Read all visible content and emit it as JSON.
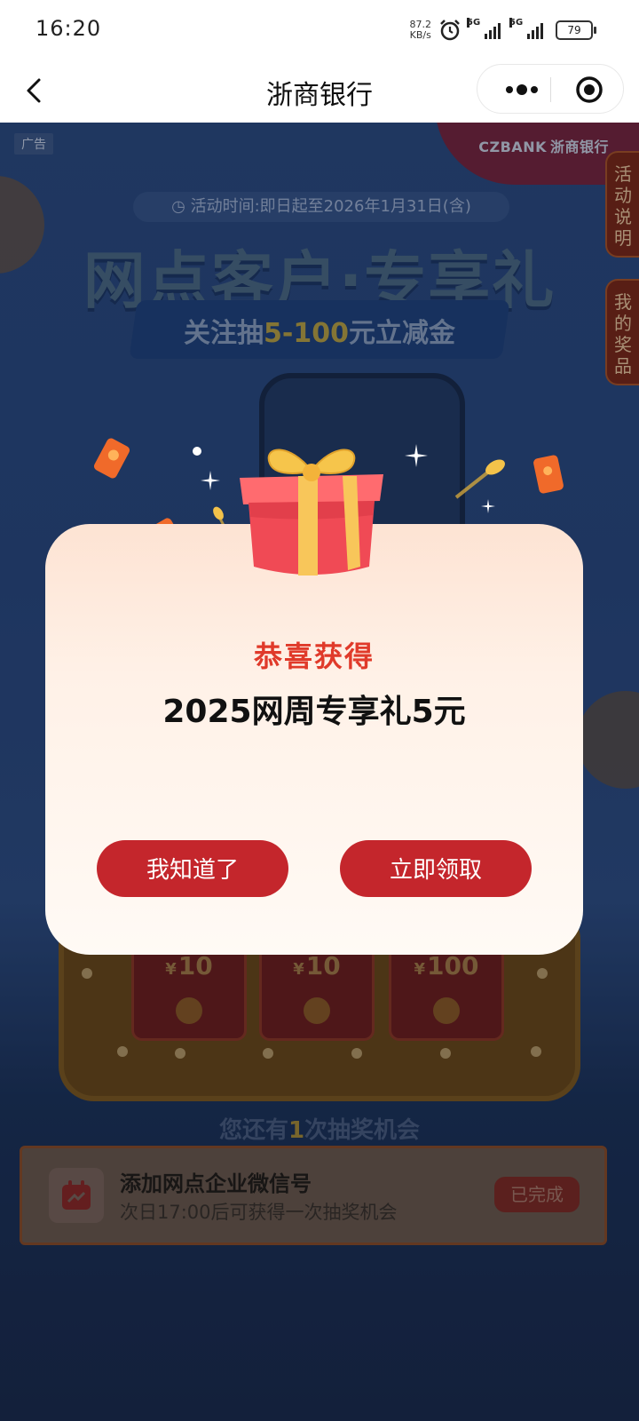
{
  "status_bar": {
    "time": "16:20",
    "net_speed_value": "87.2",
    "net_speed_unit": "KB/s",
    "sim1": "5G",
    "sim2": "5G",
    "battery": "79"
  },
  "nav": {
    "title": "浙商银行"
  },
  "background": {
    "ad_label": "广告",
    "brand_en": "CZBANK",
    "brand_cn": "浙商银行",
    "activity_time": "活动时间:即日起至2026年1月31日(含)",
    "headline": "网点客户·专享礼",
    "subline_pre": "关注抽",
    "subline_highlight": "5-100",
    "subline_post": "元立减金",
    "side_tab_rules": "活动说明",
    "side_tab_prizes": "我的奖品",
    "envelopes": [
      {
        "currency": "¥",
        "amount": "10"
      },
      {
        "currency": "¥",
        "amount": "10"
      },
      {
        "currency": "¥",
        "amount": "100"
      }
    ],
    "chance_pre": "您还有",
    "chance_count": "1",
    "chance_post": "次抽奖机会",
    "task": {
      "title": "添加网点企业微信号",
      "subtitle": "次日17:00后可获得一次抽奖机会",
      "button": "已完成"
    }
  },
  "modal": {
    "congrats": "恭喜获得",
    "prize": "2025网周专享礼5元",
    "btn_know": "我知道了",
    "btn_claim": "立即领取"
  }
}
